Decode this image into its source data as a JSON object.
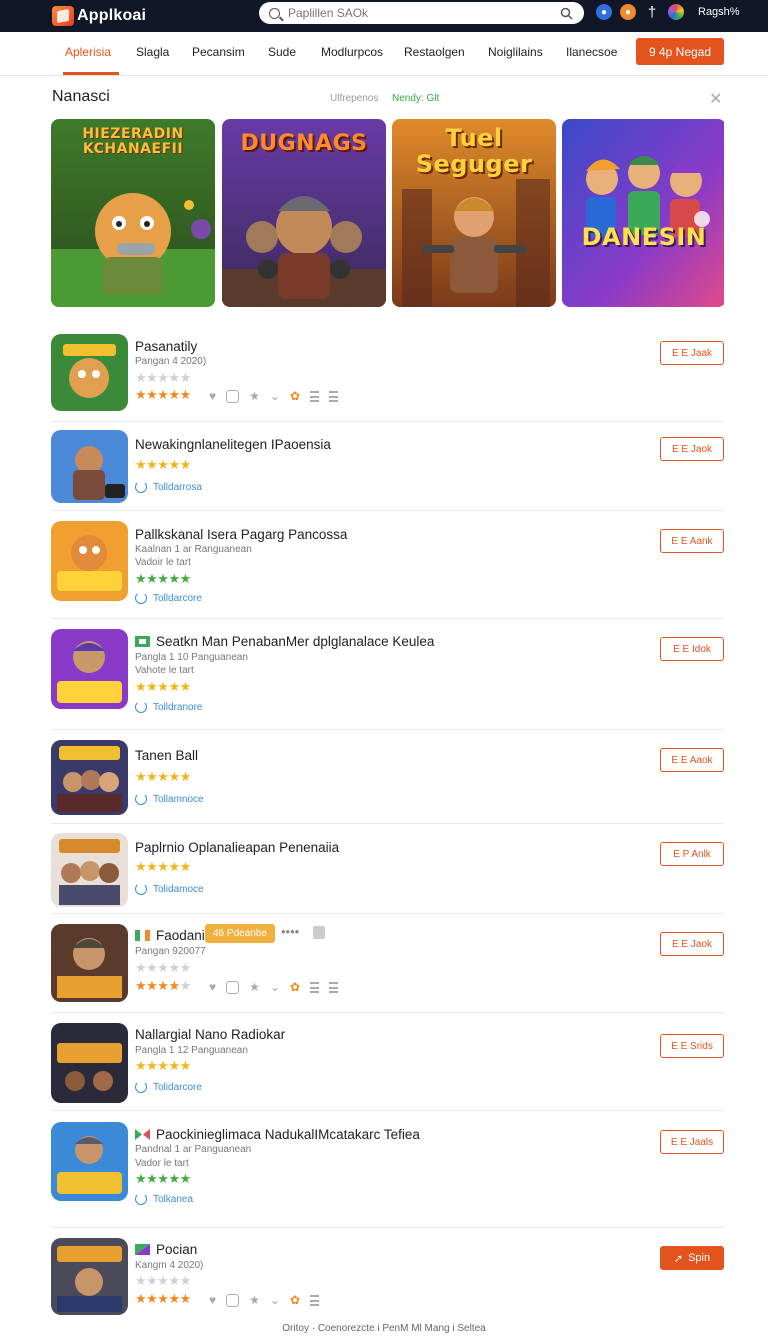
{
  "header": {
    "brand": "Applkoai",
    "search_placeholder": "Paplillen SAOk",
    "user_label": "Ragsh%"
  },
  "nav": {
    "items": [
      "Aplerisia",
      "Slagla",
      "Pecansim",
      "Sude",
      "Modlurpcos",
      "Restaolgen",
      "Noiglilains",
      "Ilanecsoe"
    ],
    "active_index": 0,
    "cta": "9 4p Negad"
  },
  "section": {
    "title": "Nanasci",
    "link": "Ulfrepenos",
    "badge": "Nendy: Glt"
  },
  "featured": [
    {
      "title": "HIEZERADIN KCHANAEFII"
    },
    {
      "title": "DUGNAGS"
    },
    {
      "title": "Tuel Seguger"
    },
    {
      "title": "DANESIN"
    }
  ],
  "apps": [
    {
      "name": "Pasanatily",
      "meta": "Pangan 4 2020)",
      "rating_color": "orange",
      "button": "E E Jaak"
    },
    {
      "name": "Newakingnlanelitegen IPaoensia",
      "link": "Tolldarrosa",
      "rating_color": "yellow",
      "button": "E E Jaok"
    },
    {
      "name": "Pallkskanal Isera Pagarg Pancossa",
      "meta": "Kaalnan 1 ar Ranguanean",
      "meta2": "Vadoir le tart",
      "rating_color": "green",
      "link": "Tolldarcore",
      "button": "E E Aank"
    },
    {
      "name": "Seatkn Man PenabanMer dplglanalace Keulea",
      "meta": "Pangla 1 10 Panguanean",
      "meta2": "Vahote le tart",
      "rating_color": "yellow",
      "link": "Tolldranore",
      "button": "E E Idok"
    },
    {
      "name": "Tanen Ball",
      "link": "Tollamnoce",
      "rating_color": "yellow",
      "button": "E E Aaok"
    },
    {
      "name": "Paplrnio Oplanalieapan Penenaiia",
      "link": "Tolidamoce",
      "rating_color": "yellow",
      "button": "E P Anlk"
    },
    {
      "name": "Faodani",
      "tag": "46 Pdeanbe",
      "meta": "Pangan 920077",
      "rating_color": "orange",
      "button": "E E Jaok"
    },
    {
      "name": "Nallargial Nano Radiokar",
      "meta": "Pangla 1 12 Panguanean",
      "link": "Tolidarcore",
      "rating_color": "yellow",
      "button": "E E Srids"
    },
    {
      "name": "Paockinieglimaca NadukalIMcatakarc Tefiea",
      "meta": "Pandnal 1 ar Panguanean",
      "meta2": "Vador le tart",
      "rating_color": "green",
      "link": "Tolkanea",
      "button": "E E Jaals"
    },
    {
      "name": "Pocian",
      "meta": "Kangm 4 2020)",
      "rating_color": "orange",
      "button": "Spin"
    }
  ],
  "footer": "Oritoy · Coenorezcte i PenM Ml Mang i Seltea",
  "colors": {
    "accent": "#e2531e",
    "topbar": "#121727",
    "link": "#3a8ed8"
  }
}
